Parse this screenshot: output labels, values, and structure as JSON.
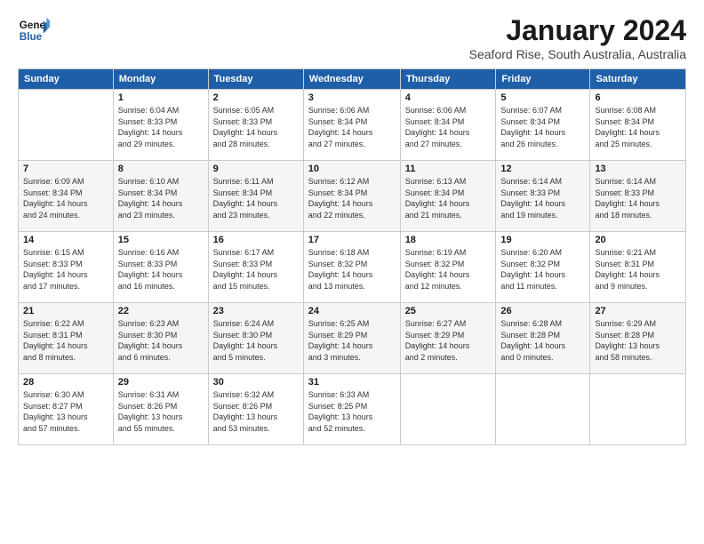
{
  "logo": {
    "line1": "General",
    "line2": "Blue"
  },
  "title": "January 2024",
  "location": "Seaford Rise, South Australia, Australia",
  "days_of_week": [
    "Sunday",
    "Monday",
    "Tuesday",
    "Wednesday",
    "Thursday",
    "Friday",
    "Saturday"
  ],
  "weeks": [
    [
      {
        "day": "",
        "sunrise": "",
        "sunset": "",
        "daylight": ""
      },
      {
        "day": "1",
        "sunrise": "Sunrise: 6:04 AM",
        "sunset": "Sunset: 8:33 PM",
        "daylight": "Daylight: 14 hours and 29 minutes."
      },
      {
        "day": "2",
        "sunrise": "Sunrise: 6:05 AM",
        "sunset": "Sunset: 8:33 PM",
        "daylight": "Daylight: 14 hours and 28 minutes."
      },
      {
        "day": "3",
        "sunrise": "Sunrise: 6:06 AM",
        "sunset": "Sunset: 8:34 PM",
        "daylight": "Daylight: 14 hours and 27 minutes."
      },
      {
        "day": "4",
        "sunrise": "Sunrise: 6:06 AM",
        "sunset": "Sunset: 8:34 PM",
        "daylight": "Daylight: 14 hours and 27 minutes."
      },
      {
        "day": "5",
        "sunrise": "Sunrise: 6:07 AM",
        "sunset": "Sunset: 8:34 PM",
        "daylight": "Daylight: 14 hours and 26 minutes."
      },
      {
        "day": "6",
        "sunrise": "Sunrise: 6:08 AM",
        "sunset": "Sunset: 8:34 PM",
        "daylight": "Daylight: 14 hours and 25 minutes."
      }
    ],
    [
      {
        "day": "7",
        "sunrise": "Sunrise: 6:09 AM",
        "sunset": "Sunset: 8:34 PM",
        "daylight": "Daylight: 14 hours and 24 minutes."
      },
      {
        "day": "8",
        "sunrise": "Sunrise: 6:10 AM",
        "sunset": "Sunset: 8:34 PM",
        "daylight": "Daylight: 14 hours and 23 minutes."
      },
      {
        "day": "9",
        "sunrise": "Sunrise: 6:11 AM",
        "sunset": "Sunset: 8:34 PM",
        "daylight": "Daylight: 14 hours and 23 minutes."
      },
      {
        "day": "10",
        "sunrise": "Sunrise: 6:12 AM",
        "sunset": "Sunset: 8:34 PM",
        "daylight": "Daylight: 14 hours and 22 minutes."
      },
      {
        "day": "11",
        "sunrise": "Sunrise: 6:13 AM",
        "sunset": "Sunset: 8:34 PM",
        "daylight": "Daylight: 14 hours and 21 minutes."
      },
      {
        "day": "12",
        "sunrise": "Sunrise: 6:14 AM",
        "sunset": "Sunset: 8:33 PM",
        "daylight": "Daylight: 14 hours and 19 minutes."
      },
      {
        "day": "13",
        "sunrise": "Sunrise: 6:14 AM",
        "sunset": "Sunset: 8:33 PM",
        "daylight": "Daylight: 14 hours and 18 minutes."
      }
    ],
    [
      {
        "day": "14",
        "sunrise": "Sunrise: 6:15 AM",
        "sunset": "Sunset: 8:33 PM",
        "daylight": "Daylight: 14 hours and 17 minutes."
      },
      {
        "day": "15",
        "sunrise": "Sunrise: 6:16 AM",
        "sunset": "Sunset: 8:33 PM",
        "daylight": "Daylight: 14 hours and 16 minutes."
      },
      {
        "day": "16",
        "sunrise": "Sunrise: 6:17 AM",
        "sunset": "Sunset: 8:33 PM",
        "daylight": "Daylight: 14 hours and 15 minutes."
      },
      {
        "day": "17",
        "sunrise": "Sunrise: 6:18 AM",
        "sunset": "Sunset: 8:32 PM",
        "daylight": "Daylight: 14 hours and 13 minutes."
      },
      {
        "day": "18",
        "sunrise": "Sunrise: 6:19 AM",
        "sunset": "Sunset: 8:32 PM",
        "daylight": "Daylight: 14 hours and 12 minutes."
      },
      {
        "day": "19",
        "sunrise": "Sunrise: 6:20 AM",
        "sunset": "Sunset: 8:32 PM",
        "daylight": "Daylight: 14 hours and 11 minutes."
      },
      {
        "day": "20",
        "sunrise": "Sunrise: 6:21 AM",
        "sunset": "Sunset: 8:31 PM",
        "daylight": "Daylight: 14 hours and 9 minutes."
      }
    ],
    [
      {
        "day": "21",
        "sunrise": "Sunrise: 6:22 AM",
        "sunset": "Sunset: 8:31 PM",
        "daylight": "Daylight: 14 hours and 8 minutes."
      },
      {
        "day": "22",
        "sunrise": "Sunrise: 6:23 AM",
        "sunset": "Sunset: 8:30 PM",
        "daylight": "Daylight: 14 hours and 6 minutes."
      },
      {
        "day": "23",
        "sunrise": "Sunrise: 6:24 AM",
        "sunset": "Sunset: 8:30 PM",
        "daylight": "Daylight: 14 hours and 5 minutes."
      },
      {
        "day": "24",
        "sunrise": "Sunrise: 6:25 AM",
        "sunset": "Sunset: 8:29 PM",
        "daylight": "Daylight: 14 hours and 3 minutes."
      },
      {
        "day": "25",
        "sunrise": "Sunrise: 6:27 AM",
        "sunset": "Sunset: 8:29 PM",
        "daylight": "Daylight: 14 hours and 2 minutes."
      },
      {
        "day": "26",
        "sunrise": "Sunrise: 6:28 AM",
        "sunset": "Sunset: 8:28 PM",
        "daylight": "Daylight: 14 hours and 0 minutes."
      },
      {
        "day": "27",
        "sunrise": "Sunrise: 6:29 AM",
        "sunset": "Sunset: 8:28 PM",
        "daylight": "Daylight: 13 hours and 58 minutes."
      }
    ],
    [
      {
        "day": "28",
        "sunrise": "Sunrise: 6:30 AM",
        "sunset": "Sunset: 8:27 PM",
        "daylight": "Daylight: 13 hours and 57 minutes."
      },
      {
        "day": "29",
        "sunrise": "Sunrise: 6:31 AM",
        "sunset": "Sunset: 8:26 PM",
        "daylight": "Daylight: 13 hours and 55 minutes."
      },
      {
        "day": "30",
        "sunrise": "Sunrise: 6:32 AM",
        "sunset": "Sunset: 8:26 PM",
        "daylight": "Daylight: 13 hours and 53 minutes."
      },
      {
        "day": "31",
        "sunrise": "Sunrise: 6:33 AM",
        "sunset": "Sunset: 8:25 PM",
        "daylight": "Daylight: 13 hours and 52 minutes."
      },
      {
        "day": "",
        "sunrise": "",
        "sunset": "",
        "daylight": ""
      },
      {
        "day": "",
        "sunrise": "",
        "sunset": "",
        "daylight": ""
      },
      {
        "day": "",
        "sunrise": "",
        "sunset": "",
        "daylight": ""
      }
    ]
  ]
}
